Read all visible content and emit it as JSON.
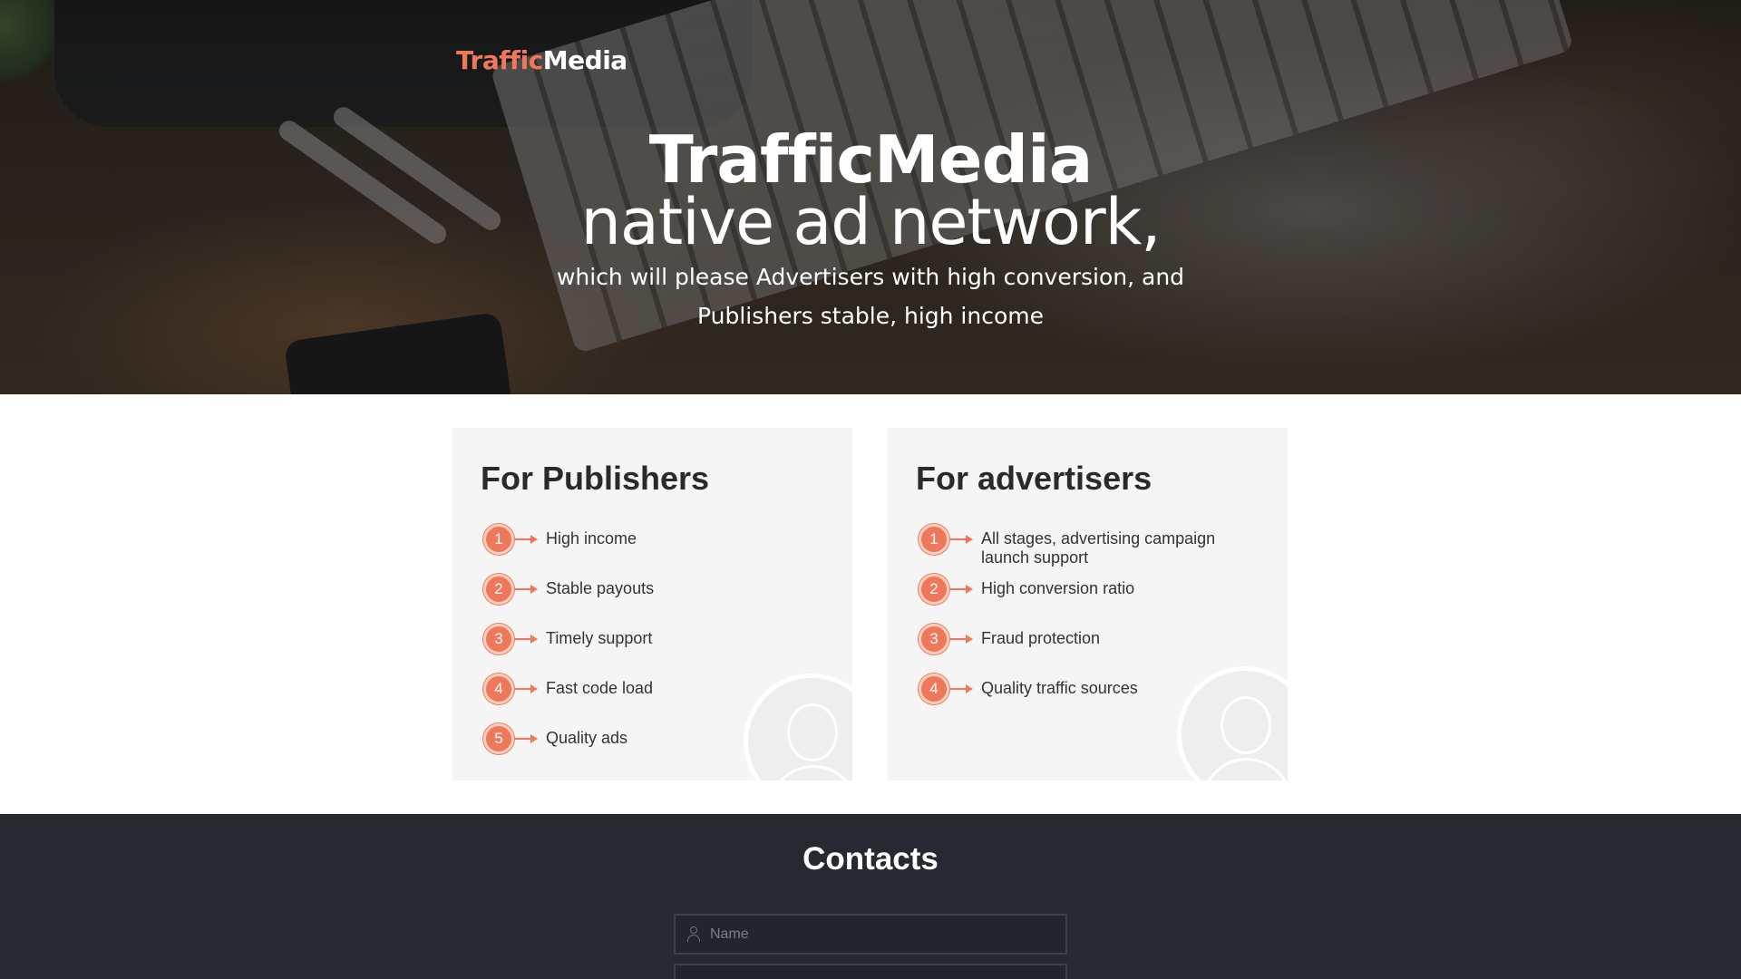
{
  "brand": {
    "part1": "Traffic",
    "part2": "Media"
  },
  "hero": {
    "title": "TrafficMedia",
    "subtitle": "native ad network,",
    "description": "which will please Advertisers with high conversion, and Publishers stable, high income"
  },
  "publishers": {
    "title": "For Publishers",
    "items": [
      {
        "num": "1",
        "label": "High income"
      },
      {
        "num": "2",
        "label": "Stable payouts"
      },
      {
        "num": "3",
        "label": "Timely support"
      },
      {
        "num": "4",
        "label": "Fast code load"
      },
      {
        "num": "5",
        "label": "Quality ads"
      }
    ]
  },
  "advertisers": {
    "title": "For advertisers",
    "items": [
      {
        "num": "1",
        "label": "All stages, advertising campaign launch support"
      },
      {
        "num": "2",
        "label": "High conversion ratio"
      },
      {
        "num": "3",
        "label": "Fraud protection"
      },
      {
        "num": "4",
        "label": "Quality traffic sources"
      }
    ]
  },
  "contacts": {
    "title": "Contacts",
    "name_placeholder": "Name"
  },
  "colors": {
    "accent": "#f0785a",
    "dark_bg": "#262931",
    "card_bg": "#f5f5f5"
  },
  "icons": {
    "name_field": "user-icon"
  }
}
